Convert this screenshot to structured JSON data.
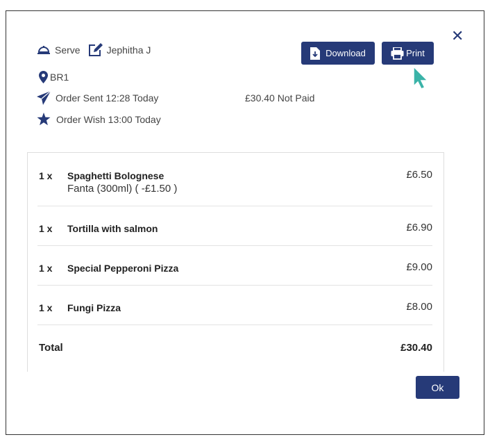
{
  "header": {
    "mode": "Serve",
    "user": "Jephitha J",
    "location": "BR1",
    "order_sent": "Order Sent 12:28 Today",
    "order_wish": "Order Wish 13:00 Today",
    "amount_status": "£30.40 Not Paid"
  },
  "toolbar": {
    "download_label": "Download",
    "print_label": "Print"
  },
  "items": [
    {
      "qty": "1 x",
      "name": "Spaghetti Bolognese",
      "modifier": "Fanta (300ml) ( -£1.50 )",
      "price": "£6.50"
    },
    {
      "qty": "1 x",
      "name": "Tortilla with salmon",
      "modifier": "",
      "price": "£6.90"
    },
    {
      "qty": "1 x",
      "name": "Special Pepperoni Pizza",
      "modifier": "",
      "price": "£9.00"
    },
    {
      "qty": "1 x",
      "name": "Fungi Pizza",
      "modifier": "",
      "price": "£8.00"
    }
  ],
  "total": {
    "label": "Total",
    "value": "£30.40"
  },
  "footer": {
    "ok_label": "Ok"
  },
  "colors": {
    "accent": "#263a78",
    "cursor": "#3bb3a8"
  }
}
